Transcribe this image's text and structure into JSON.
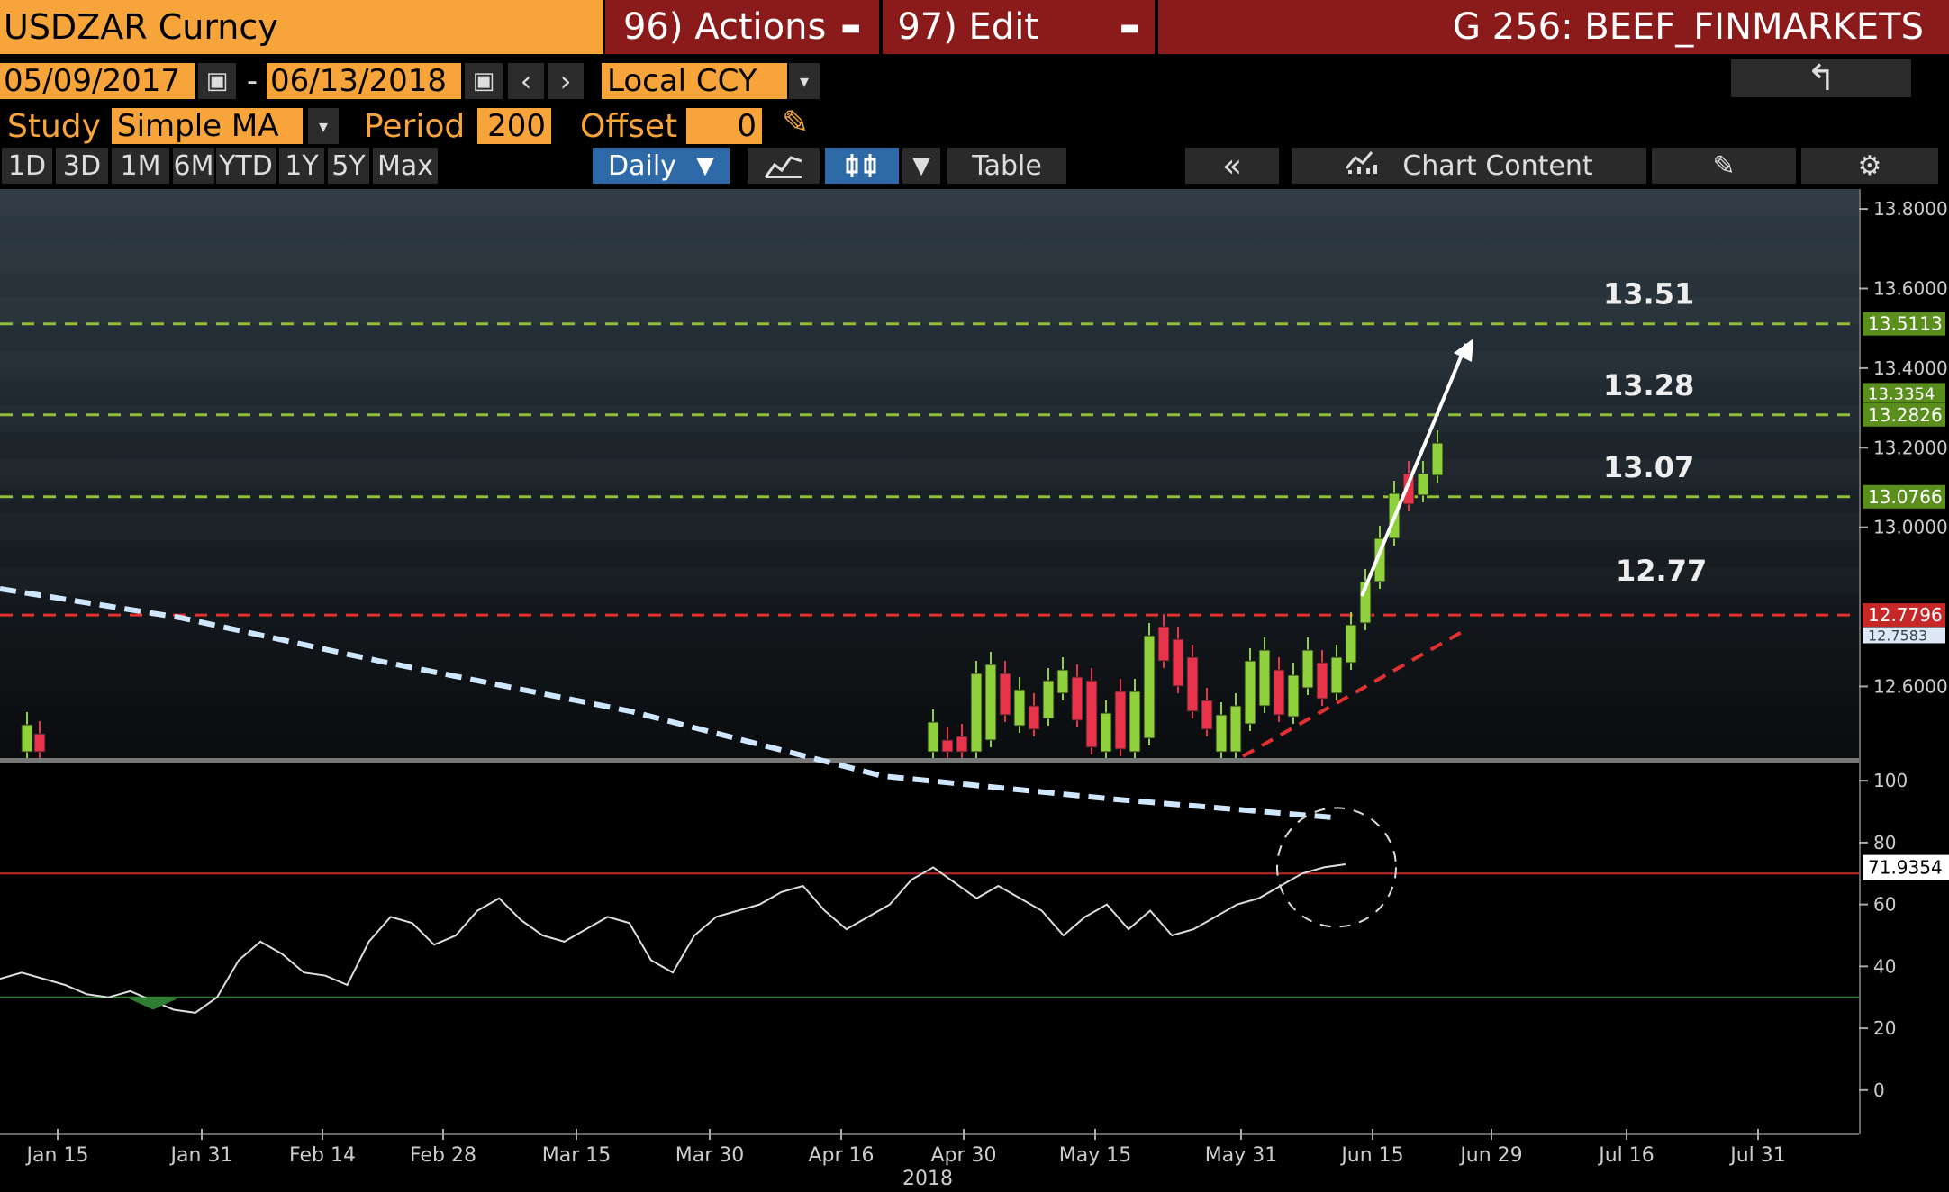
{
  "header": {
    "ticker": "USDZAR Curncy",
    "actions": "96) Actions",
    "edit": "97) Edit",
    "title": "G 256: BEEF_FINMARKETS"
  },
  "range": {
    "start": "05/09/2017",
    "end": "06/13/2018",
    "currency": "Local CCY"
  },
  "study": {
    "label": "Study",
    "value": "Simple MA",
    "period_label": "Period",
    "period_value": "200",
    "offset_label": "Offset",
    "offset_value": "0"
  },
  "toolbar": {
    "periods": [
      "1D",
      "3D",
      "1M",
      "6M",
      "YTD",
      "1Y",
      "5Y",
      "Max"
    ],
    "frequency": "Daily",
    "table": "Table",
    "chart_content": "Chart Content",
    "selected_period": ""
  },
  "chart_data": [
    {
      "type": "candlestick",
      "title": "",
      "x_ticks": [
        "Jan 15",
        "Jan 31",
        "Feb 14",
        "Feb 28",
        "Mar 15",
        "Mar 30",
        "Apr 16",
        "Apr 30",
        "May 15",
        "May 31",
        "Jun 15",
        "Jun 29",
        "Jul 16",
        "Jul 31"
      ],
      "year_label": "2018",
      "y_ticks": [
        "13.8000",
        "13.6000",
        "13.4000",
        "13.2000",
        "13.0000",
        "12.6000"
      ],
      "ylim": [
        12.42,
        13.85
      ],
      "moving_average": {
        "name": "Simple MA",
        "period": 200
      },
      "levels": [
        {
          "label": "13.51",
          "tag": "13.5113",
          "value": 13.5113,
          "color": "#8fbf3a"
        },
        {
          "label": "13.28",
          "tag": "13.2826",
          "value": 13.2826,
          "color": "#8fbf3a"
        },
        {
          "label": "13.07",
          "tag": "13.0766",
          "value": 13.0766,
          "color": "#8fbf3a"
        },
        {
          "label": "12.77",
          "tag": "12.7796",
          "value": 12.7796,
          "color": "#e03030"
        }
      ],
      "last_price_tag": "13.3354",
      "ma_tag": "12.7583"
    },
    {
      "type": "line",
      "title": "",
      "y_ticks": [
        "100",
        "80",
        "60",
        "40",
        "20",
        "0"
      ],
      "ylim": [
        -5,
        105
      ],
      "overbought": 70,
      "oversold": 30,
      "last_value_tag": "71.9354"
    }
  ],
  "colors": {
    "accent": "#f7a53a",
    "header_red": "#8b1a1a",
    "up_candle": "#8fd13a",
    "down_candle": "#e8334a",
    "ma_line": "#cfe6ff"
  }
}
